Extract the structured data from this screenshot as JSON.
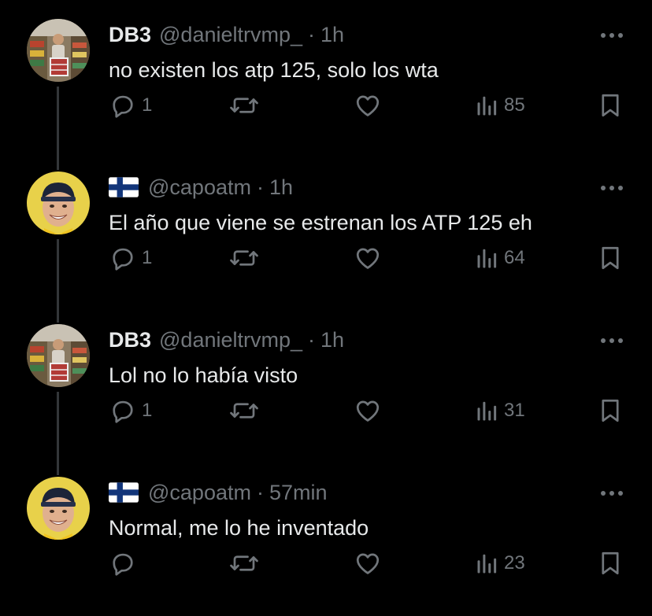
{
  "theme": {
    "background": "#000000",
    "text_primary": "#e7e9ea",
    "text_secondary": "#71767b",
    "thread_line": "#333639"
  },
  "posts": [
    {
      "display_name": "DB3",
      "handle": "@danieltrvmp_",
      "separator": "·",
      "time": "1h",
      "text": "no existen los atp 125, solo los wta",
      "avatar_icon": "shop-photo-avatar",
      "replies": "1",
      "views": "85"
    },
    {
      "display_name": "",
      "flag_icon": "finland-flag-icon",
      "handle": "@capoatm",
      "separator": "·",
      "time": "1h",
      "text": "El año que viene se estrenan los ATP 125 eh",
      "avatar_icon": "smiling-face-avatar",
      "replies": "1",
      "views": "64"
    },
    {
      "display_name": "DB3",
      "handle": "@danieltrvmp_",
      "separator": "·",
      "time": "1h",
      "text": "Lol no lo había visto",
      "avatar_icon": "shop-photo-avatar",
      "replies": "1",
      "views": "31"
    },
    {
      "display_name": "",
      "flag_icon": "finland-flag-icon",
      "handle": "@capoatm",
      "separator": "·",
      "time": "57min",
      "text": "Normal, me lo he inventado",
      "avatar_icon": "smiling-face-avatar",
      "replies": "",
      "views": "23"
    }
  ]
}
